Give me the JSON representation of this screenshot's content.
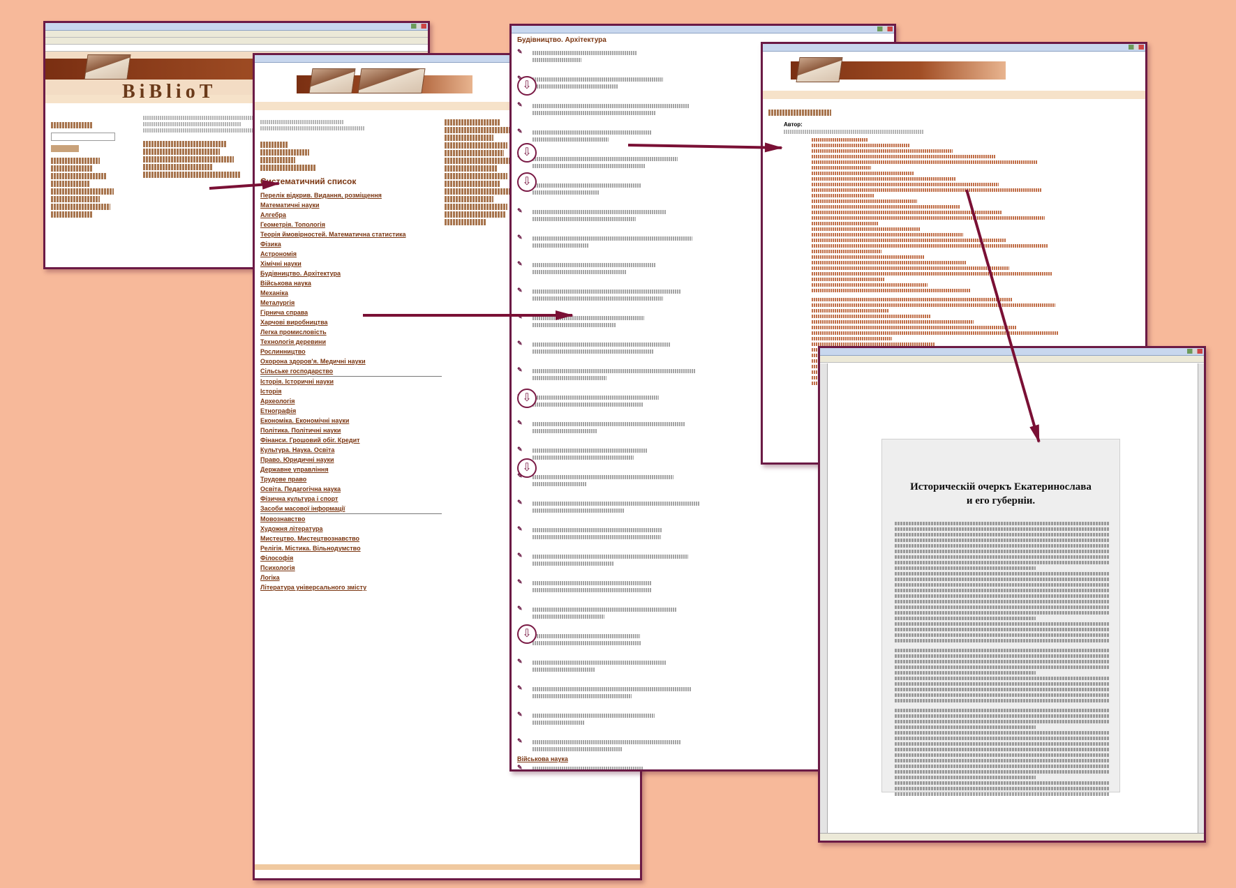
{
  "site": {
    "logo_text": "BiBlioT"
  },
  "category_page": {
    "heading": "Систематичний список",
    "highlighted_category": "Будівництво. Архітектура",
    "categories": [
      "Перелік відкрив. Видання, розміщення",
      "Математичні науки",
      "Алгебра",
      "Геометрія. Топологія",
      "Теорія ймовірностей. Математична статистика",
      "Фізика",
      "Астрономія",
      "Хімічні науки",
      "Будівництво. Архітектура",
      "Військова наука",
      "Механіка",
      "Металургія",
      "Гірнича справа",
      "Харчові виробництва",
      "Легка промисловість",
      "Технологія деревини",
      "Рослинництво",
      "Охорона здоров'я. Медичні науки",
      "Сільське господарство",
      "Історія. Історичні науки",
      "Історія",
      "Археологія",
      "Етнографія",
      "Економіка. Економічні науки",
      "Політика. Політичні науки",
      "Фінанси. Грошовий обіг. Кредит",
      "Культура. Наука. Освіта",
      "Право. Юридичні науки",
      "Державне управління",
      "Трудове право",
      "Освіта. Педагогічна наука",
      "Фізична культура і спорт",
      "Засоби масової інформації",
      "Мовознавство",
      "Художня література",
      "Мистецтво. Мистецтвознавство",
      "Релігія. Містика. Вільнодумство",
      "Філософія",
      "Психологія",
      "Логіка",
      "Література універсального змісту"
    ]
  },
  "list_page": {
    "heading": "Будівництво. Архітектура",
    "footer_link": "Військова наука"
  },
  "detail_page": {
    "label": "Автор:"
  },
  "scan": {
    "title": "Историческій очеркъ Екатеринослава\nи его губерніи."
  },
  "colors": {
    "background": "#f7b99a",
    "frame": "#6b1a45",
    "arrow": "#7a1035",
    "link": "#7a3510"
  }
}
